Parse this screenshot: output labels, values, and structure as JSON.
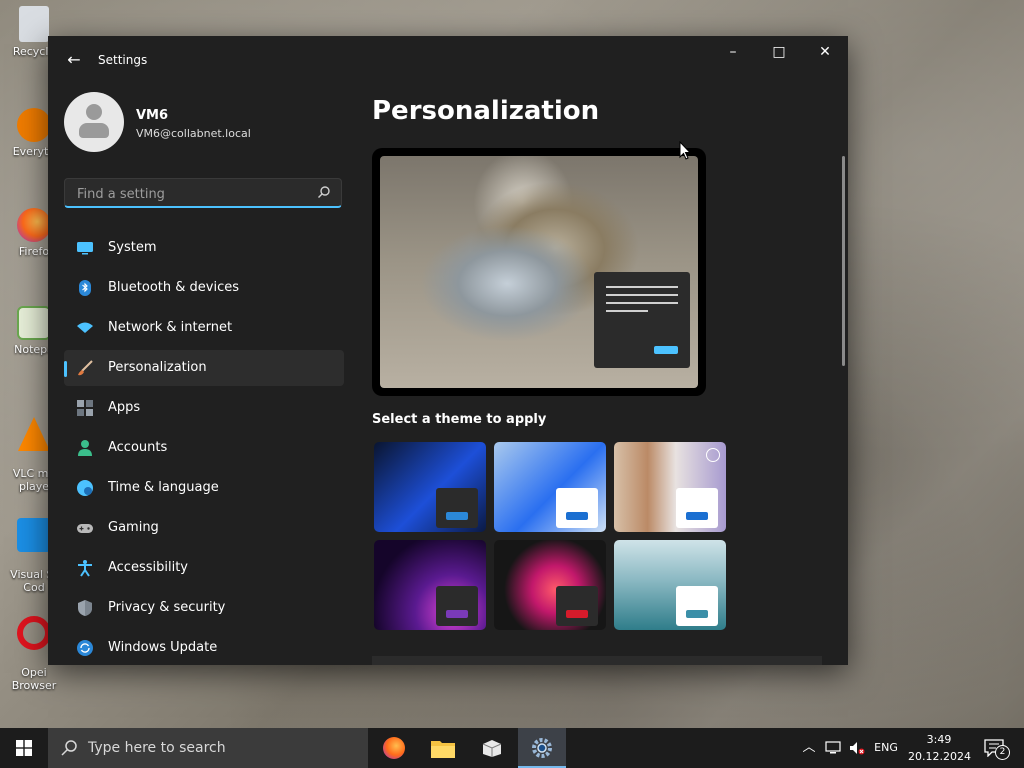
{
  "desktop": {
    "icons": [
      {
        "label": "Recycle",
        "color": "#5a9bd5"
      },
      {
        "label": "Everyth",
        "color": "#f07c00"
      },
      {
        "label": "Firefo",
        "color": "#ff6b1a"
      },
      {
        "label": "Notepa",
        "color": "#6aa84f"
      },
      {
        "label": "VLC me\nplaye",
        "color": "#ff8800"
      },
      {
        "label": "Visual St\nCod",
        "color": "#1b8fe6"
      },
      {
        "label": "Opei\nBrowser",
        "color": "#e0141e"
      }
    ]
  },
  "window": {
    "title": "Settings",
    "back_icon": "←",
    "min_icon": "–",
    "max_icon": "□",
    "close_icon": "✕"
  },
  "profile": {
    "name": "VM6",
    "email": "VM6@collabnet.local"
  },
  "search": {
    "placeholder": "Find a setting",
    "value": ""
  },
  "nav": {
    "items": [
      {
        "label": "System",
        "icon": "monitor-icon",
        "color": "#4cc2ff"
      },
      {
        "label": "Bluetooth & devices",
        "icon": "bluetooth-icon",
        "color": "#2b88d8"
      },
      {
        "label": "Network & internet",
        "icon": "wifi-icon",
        "color": "#4cc2ff"
      },
      {
        "label": "Personalization",
        "icon": "brush-icon",
        "color": "#e0a060",
        "selected": true
      },
      {
        "label": "Apps",
        "icon": "apps-icon",
        "color": "#9aa3ad"
      },
      {
        "label": "Accounts",
        "icon": "person-icon",
        "color": "#3bbf8c"
      },
      {
        "label": "Time & language",
        "icon": "globe-clock-icon",
        "color": "#4cc2ff"
      },
      {
        "label": "Gaming",
        "icon": "gamepad-icon",
        "color": "#b9b9b9"
      },
      {
        "label": "Accessibility",
        "icon": "accessibility-icon",
        "color": "#4cc2ff"
      },
      {
        "label": "Privacy & security",
        "icon": "shield-icon",
        "color": "#9aa3ad"
      },
      {
        "label": "Windows Update",
        "icon": "update-icon",
        "color": "#2b88d8"
      }
    ]
  },
  "main": {
    "title": "Personalization",
    "themes_heading": "Select a theme to apply",
    "themes": [
      {
        "name": "windows-dark",
        "bg": "linear-gradient(135deg,#0a1530,#1d4fd8 55%,#0b1a44)",
        "mini": "#2b2b2b",
        "bar": "#2b88d8"
      },
      {
        "name": "windows-light",
        "bg": "linear-gradient(135deg,#a9c9ee,#2a6ff0 55%,#cfe1f5)",
        "mini": "#ffffff",
        "bar": "#1b6fd1"
      },
      {
        "name": "spotlight",
        "bg": "linear-gradient(90deg,#d7c0a8 0%,#bb8a66 30%,#e8e2e0 55%,#a79ad0 100%)",
        "mini": "#ffffff",
        "bar": "#1b6fd1"
      },
      {
        "name": "glow",
        "bg": "radial-gradient(circle at 70% 80%,#e245d8,#5a1a90 35%,#15052a 75%)",
        "mini": "#2b2b2b",
        "bar": "#7a3ab8"
      },
      {
        "name": "captured-motion",
        "bg": "radial-gradient(circle at 55% 55%,#ff5a6a,#c2186b 30%,#161616 65%)",
        "mini": "#2b2b2b",
        "bar": "#d61b2b"
      },
      {
        "name": "flow",
        "bg": "linear-gradient(180deg,#cfe3e8 0%,#8ab8c2 45%,#2f7d8a 100%)",
        "mini": "#ffffff",
        "bar": "#3b8fa8"
      }
    ]
  },
  "taskbar": {
    "search_placeholder": "Type here to search",
    "lang": "ENG",
    "time": "3:49",
    "date": "20.12.2024",
    "notif_count": "2"
  }
}
